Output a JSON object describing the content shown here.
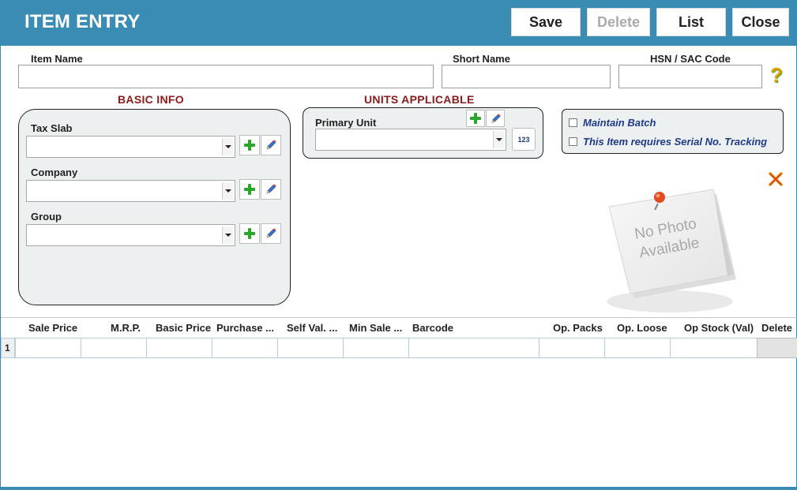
{
  "header": {
    "title": "ITEM ENTRY",
    "buttons": {
      "save": "Save",
      "delete": "Delete",
      "list": "List",
      "close": "Close"
    }
  },
  "fields": {
    "item_name_label": "Item Name",
    "short_name_label": "Short Name",
    "hsn_label": "HSN / SAC Code",
    "item_name_value": "",
    "short_name_value": "",
    "hsn_value": "",
    "help_glyph": "?"
  },
  "basic_info": {
    "title": "BASIC INFO",
    "tax_slab_label": "Tax Slab",
    "company_label": "Company",
    "group_label": "Group"
  },
  "units": {
    "title": "UNITS APPLICABLE",
    "primary_unit_label": "Primary Unit",
    "numbering_glyph": "123"
  },
  "options": {
    "maintain_batch": "Maintain Batch",
    "serial_tracking": "This Item requires Serial No. Tracking"
  },
  "photo": {
    "line1": "No Photo",
    "line2": "Available"
  },
  "grid": {
    "columns": [
      "Sale Price",
      "M.R.P.",
      "Basic Price",
      "Purchase ...",
      "Self Val. ...",
      "Min Sale ...",
      "Barcode",
      "Op. Packs",
      "Op. Loose",
      "Op Stock (Val)",
      "Delete"
    ],
    "rows": [
      {
        "num": "1"
      }
    ]
  },
  "colors": {
    "header_bg": "#3a8cb4",
    "section_title": "#8b1a1a",
    "option_text": "#1f3a8a"
  }
}
